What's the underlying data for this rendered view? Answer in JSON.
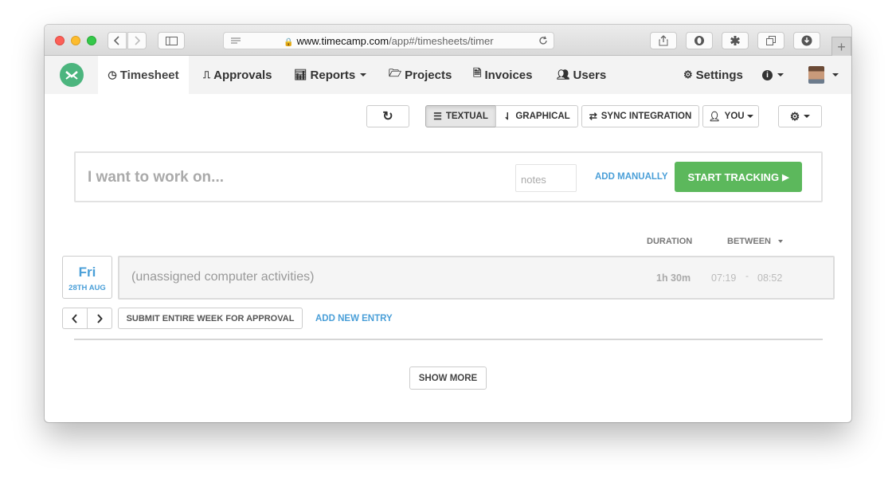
{
  "browser": {
    "url_host": "www.timecamp.com",
    "url_path": "/app#/timesheets/timer",
    "new_tab_symbol": "+"
  },
  "nav": {
    "timesheet": "Timesheet",
    "approvals": "Approvals",
    "reports": "Reports",
    "projects": "Projects",
    "invoices": "Invoices",
    "users": "Users",
    "settings": "Settings"
  },
  "toolbar": {
    "refresh_icon": "↻",
    "textual": "TEXTUAL",
    "graphical": "GRAPHICAL",
    "sync": "SYNC INTEGRATION",
    "you": "YOU"
  },
  "tracker": {
    "task_placeholder": "I want to work on...",
    "notes_placeholder": "notes",
    "add_manually": "ADD MANUALLY",
    "start_tracking": "START TRACKING"
  },
  "columns": {
    "duration": "DURATION",
    "between": "BETWEEN"
  },
  "day": {
    "weekday": "Fri",
    "date": "28TH AUG"
  },
  "entry": {
    "title": "(unassigned computer activities)",
    "duration": "1h 30m",
    "start": "07:19",
    "separator": "-",
    "end": "08:52"
  },
  "actions": {
    "submit_week": "SUBMIT ENTIRE WEEK FOR APPROVAL",
    "add_entry": "ADD NEW ENTRY",
    "show_more": "SHOW MORE"
  },
  "colors": {
    "accent": "#4a9fd8",
    "start_button": "#5cb85c",
    "logo": "#4cb57e"
  }
}
